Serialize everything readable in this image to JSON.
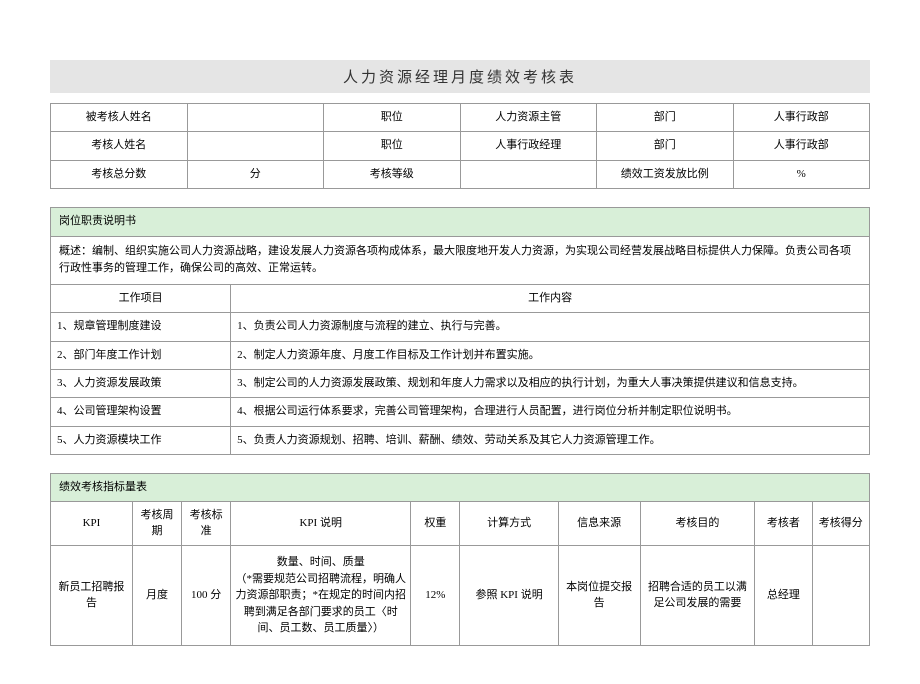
{
  "title": "人力资源经理月度绩效考核表",
  "info": {
    "row1": {
      "label1": "被考核人姓名",
      "val1": "",
      "label2": "职位",
      "val2": "人力资源主管",
      "label3": "部门",
      "val3": "人事行政部"
    },
    "row2": {
      "label1": "考核人姓名",
      "val1": "",
      "label2": "职位",
      "val2": "人事行政经理",
      "label3": "部门",
      "val3": "人事行政部"
    },
    "row3": {
      "label1": "考核总分数",
      "val1": "分",
      "label2": "考核等级",
      "val2": "",
      "label3": "绩效工资发放比例",
      "val3": "%"
    }
  },
  "job": {
    "header": "岗位职责说明书",
    "overview": "概述：编制、组织实施公司人力资源战略，建设发展人力资源各项构成体系，最大限度地开发人力资源，为实现公司经营发展战略目标提供人力保障。负责公司各项行政性事务的管理工作，确保公司的高效、正常运转。",
    "col_project": "工作项目",
    "col_content": "工作内容",
    "items": [
      {
        "proj": "1、规章管理制度建设",
        "content": "1、负责公司人力资源制度与流程的建立、执行与完善。"
      },
      {
        "proj": "2、部门年度工作计划",
        "content": "2、制定人力资源年度、月度工作目标及工作计划并布置实施。"
      },
      {
        "proj": "3、人力资源发展政策",
        "content": "3、制定公司的人力资源发展政策、规划和年度人力需求以及相应的执行计划，为重大人事决策提供建议和信息支持。"
      },
      {
        "proj": "4、公司管理架构设置",
        "content": "4、根据公司运行体系要求，完善公司管理架构，合理进行人员配置，进行岗位分析并制定职位说明书。"
      },
      {
        "proj": "5、人力资源模块工作",
        "content": "5、负责人力资源规划、招聘、培训、薪酬、绩效、劳动关系及其它人力资源管理工作。"
      }
    ]
  },
  "kpi": {
    "header": "绩效考核指标量表",
    "cols": {
      "c1": "KPI",
      "c2": "考核周期",
      "c3": "考核标准",
      "c4": "KPI 说明",
      "c5": "权重",
      "c6": "计算方式",
      "c7": "信息来源",
      "c8": "考核目的",
      "c9": "考核者",
      "c10": "考核得分"
    },
    "row1": {
      "kpi": "新员工招聘报告",
      "period": "月度",
      "standard": "100 分",
      "desc": "数量、时间、质量\n（*需要规范公司招聘流程，明确人力资源部职责；*在规定的时间内招聘到满足各部门要求的员工〈时间、员工数、员工质量〉）",
      "weight": "12%",
      "calc": "参照 KPI 说明",
      "source": "本岗位提交报告",
      "purpose": "招聘合适的员工以满足公司发展的需要",
      "assessor": "总经理",
      "score": ""
    }
  }
}
